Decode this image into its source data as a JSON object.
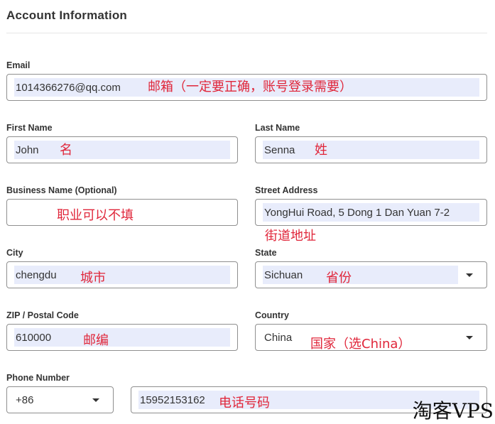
{
  "section": {
    "title": "Account Information"
  },
  "fields": {
    "email": {
      "label": "Email",
      "value": "1014366276@qq.com",
      "note": "邮箱（一定要正确，账号登录需要）"
    },
    "first_name": {
      "label": "First Name",
      "value": "John",
      "note": "名"
    },
    "last_name": {
      "label": "Last Name",
      "value": "Senna",
      "note": "姓"
    },
    "business_name": {
      "label": "Business Name (Optional)",
      "value": "",
      "note": "职业可以不填"
    },
    "street_address": {
      "label": "Street Address",
      "value": "YongHui Road, 5 Dong 1 Dan Yuan 7-2",
      "note": "街道地址"
    },
    "city": {
      "label": "City",
      "value": "chengdu",
      "note": "城市"
    },
    "state": {
      "label": "State",
      "value": "Sichuan",
      "note": "省份"
    },
    "zip": {
      "label": "ZIP / Postal Code",
      "value": "610000",
      "note": "邮编"
    },
    "country": {
      "label": "Country",
      "value": "China",
      "note": "国家（选China）"
    },
    "phone": {
      "label": "Phone Number",
      "country_code": "+86",
      "value": "15952153162",
      "note": "电话号码"
    }
  },
  "watermark": "淘客VPS",
  "colors": {
    "annotation": "#e0263a",
    "autofill": "#e8ecfb",
    "border": "#8f8f8f"
  }
}
